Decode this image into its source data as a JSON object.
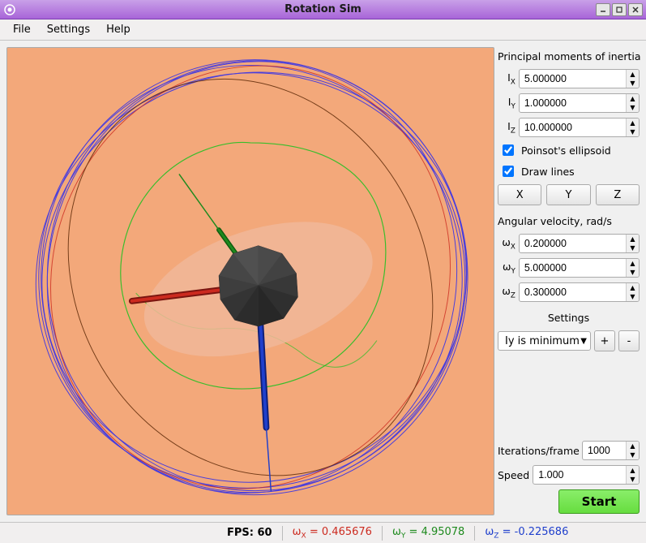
{
  "window": {
    "title": "Rotation Sim"
  },
  "menu": {
    "file": "File",
    "settings": "Settings",
    "help": "Help"
  },
  "side": {
    "moments_title": "Principal moments of inertia",
    "Ix_label": "I",
    "Iy_label": "I",
    "Iz_label": "I",
    "Ix_sub": "X",
    "Iy_sub": "Y",
    "Iz_sub": "Z",
    "Ix": "5.000000",
    "Iy": "1.000000",
    "Iz": "10.000000",
    "poinsot_label": "Poinsot's ellipsoid",
    "poinsot_checked": true,
    "drawlines_label": "Draw lines",
    "drawlines_checked": true,
    "btn_x": "X",
    "btn_y": "Y",
    "btn_z": "Z",
    "angular_title": "Angular velocity, rad/s",
    "wx_label": "ω",
    "wy_label": "ω",
    "wz_label": "ω",
    "wx_sub": "X",
    "wy_sub": "Y",
    "wz_sub": "Z",
    "wx": "0.200000",
    "wy": "5.000000",
    "wz": "0.300000",
    "settings_title": "Settings",
    "settings_select": "Iy is minimum",
    "plus": "+",
    "minus": "-",
    "iterations_label": "Iterations/frame",
    "iterations": "1000",
    "speed_label": "Speed",
    "speed": "1.000",
    "start": "Start"
  },
  "status": {
    "fps_label": "FPS:",
    "fps": "60",
    "wx_label": "ω",
    "wx_sub": "X",
    "wx": "0.465676",
    "wy_label": "ω",
    "wy_sub": "Y",
    "wy": "4.95078",
    "wz_label": "ω",
    "wz_sub": "Z",
    "wz": "-0.225686"
  },
  "colors": {
    "viewport_bg": "#f3a87a",
    "accent_purple": "#a865d8",
    "start_green": "#66dd3f",
    "axis_x": "#cc2a1f",
    "axis_y": "#1e8a1e",
    "axis_z": "#1f3fcc"
  }
}
